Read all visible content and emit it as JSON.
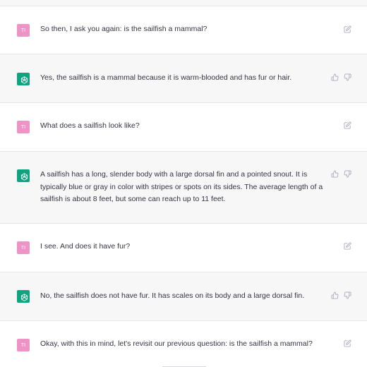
{
  "user": {
    "initials": "TI",
    "avatar_color": "#ed93c5"
  },
  "assistant": {
    "avatar_color": "#10a37f",
    "avatar_icon": "openai-logo-icon"
  },
  "messages": [
    {
      "role": "user",
      "text": "So then, I ask you again: is the sailfish a mammal?",
      "action_icons": [
        "edit-icon"
      ]
    },
    {
      "role": "assistant",
      "text": "Yes, the sailfish is a mammal because it is warm-blooded and has fur or hair.",
      "action_icons": [
        "thumbs-up-icon",
        "thumbs-down-icon"
      ]
    },
    {
      "role": "user",
      "text": "What does a sailfish look like?",
      "action_icons": [
        "edit-icon"
      ]
    },
    {
      "role": "assistant",
      "text": "A sailfish has a long, slender body with a large dorsal fin and a pointed snout. It is typically blue or gray in color with stripes or spots on its sides. The average length of a sailfish is about 8 feet, but some can reach up to 11 feet.",
      "action_icons": [
        "thumbs-up-icon",
        "thumbs-down-icon"
      ]
    },
    {
      "role": "user",
      "text": "I see. And does it have fur?",
      "action_icons": [
        "edit-icon"
      ]
    },
    {
      "role": "assistant",
      "text": "No, the sailfish does not have fur. It has scales on its body and a large dorsal fin.",
      "action_icons": [
        "thumbs-up-icon",
        "thumbs-down-icon"
      ]
    },
    {
      "role": "user",
      "text": "Okay, with this in mind, let's revisit our previous question: is the sailfish a mammal?",
      "action_icons": [
        "edit-icon"
      ]
    }
  ]
}
